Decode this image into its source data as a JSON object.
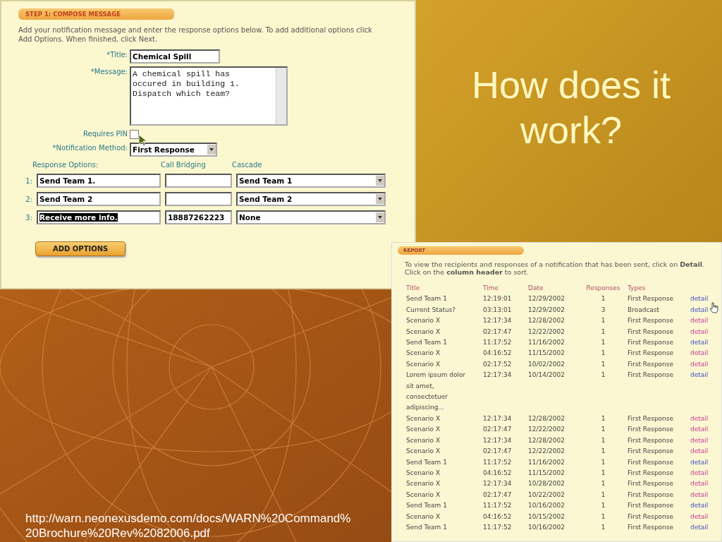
{
  "slide": {
    "title": "How does it work?",
    "source_url": "http://warn.neonexusdemo.com/docs/WARN%20Command%20Brochure%20Rev%2082006.pdf"
  },
  "compose": {
    "header": "STEP 1: COMPOSE MESSAGE",
    "instructions": "Add your notification message and enter the response options below. To add additional options click Add Options. When finished, click Next.",
    "title_label": "*Title:",
    "title_value": "Chemical Spill",
    "message_label": "*Message:",
    "message_value": "A chemical spill has occured in building 1. Dispatch which team?",
    "pin_label": "Requires PIN",
    "pin_checked": false,
    "method_label": "*Notification Method:",
    "method_value": "First Response",
    "columns": [
      "Response Options:",
      "Call Bridging",
      "Cascade"
    ],
    "options": [
      {
        "number": "1:",
        "response": "Send Team 1.",
        "cascade": "Send Team 1",
        "highlighted": false
      },
      {
        "number": "2:",
        "response": "Send Team 2",
        "cascade": "Send Team 2",
        "highlighted": false
      },
      {
        "number": "3:",
        "response": "Receive more info.",
        "bridging": "18887262223",
        "cascade": "None",
        "highlighted": true
      }
    ],
    "add_button": "ADD OPTIONS"
  },
  "report": {
    "header": "REPORT",
    "instructions": "To view the recipients and responses of a notification that has been sent, click on **Detail**. Click on the **column header** to sort.",
    "columns": [
      "Title",
      "Time",
      "Date",
      "Responses",
      "Types"
    ],
    "rows": [
      {
        "title": "Send Team 1",
        "time": "12:19:01",
        "date": "12/29/2002",
        "responses": "1",
        "type": "First Response",
        "link": "detail",
        "visited": false
      },
      {
        "title": "Current Status?",
        "time": "03:13:01",
        "date": "12/29/2002",
        "responses": "3",
        "type": "Broadcast",
        "link": "detail",
        "visited": false
      },
      {
        "title": "Scenario X",
        "time": "12:17:34",
        "date": "12/28/2002",
        "responses": "1",
        "type": "First Response",
        "link": "detail",
        "visited": true
      },
      {
        "title": "Scenario X",
        "time": "02:17:47",
        "date": "12/22/2002",
        "responses": "1",
        "type": "First Response",
        "link": "detail",
        "visited": true
      },
      {
        "title": "Send Team 1",
        "time": "11:17:52",
        "date": "11/16/2002",
        "responses": "1",
        "type": "First Response",
        "link": "detail",
        "visited": false
      },
      {
        "title": "Scenario X",
        "time": "04:16:52",
        "date": "11/15/2002",
        "responses": "1",
        "type": "First Response",
        "link": "detail",
        "visited": true
      },
      {
        "title": "Scenario X",
        "time": "02:17:52",
        "date": "10/02/2002",
        "responses": "1",
        "type": "First Response",
        "link": "detail",
        "visited": true
      },
      {
        "title": "Lorem ipsum dolor sit amet, consectetuer adipiscing...",
        "time": "12:17:34",
        "date": "10/14/2002",
        "responses": "1",
        "type": "First Response",
        "link": "detail",
        "visited": false
      },
      {
        "title": "Scenario X",
        "time": "12:17:34",
        "date": "12/28/2002",
        "responses": "1",
        "type": "First Response",
        "link": "detail",
        "visited": true
      },
      {
        "title": "Scenario X",
        "time": "02:17:47",
        "date": "12/22/2002",
        "responses": "1",
        "type": "First Response",
        "link": "detail",
        "visited": true
      },
      {
        "title": "Scenario X",
        "time": "12:17:34",
        "date": "12/28/2002",
        "responses": "1",
        "type": "First Response",
        "link": "detail",
        "visited": true
      },
      {
        "title": "Scenario X",
        "time": "02:17:47",
        "date": "12/22/2002",
        "responses": "1",
        "type": "First Response",
        "link": "detail",
        "visited": true
      },
      {
        "title": "Send Team 1",
        "time": "11:17:52",
        "date": "11/16/2002",
        "responses": "1",
        "type": "First Response",
        "link": "detail",
        "visited": false
      },
      {
        "title": "Scenario X",
        "time": "04:16:52",
        "date": "11/15/2002",
        "responses": "1",
        "type": "First Response",
        "link": "detail",
        "visited": true
      },
      {
        "title": "Scenario X",
        "time": "12:17:34",
        "date": "10/28/2002",
        "responses": "1",
        "type": "First Response",
        "link": "detail",
        "visited": true
      },
      {
        "title": "Scenario X",
        "time": "02:17:47",
        "date": "10/22/2002",
        "responses": "1",
        "type": "First Response",
        "link": "detail",
        "visited": true
      },
      {
        "title": "Send Team 1",
        "time": "11:17:52",
        "date": "10/16/2002",
        "responses": "1",
        "type": "First Response",
        "link": "detail",
        "visited": false
      },
      {
        "title": "Scenario X",
        "time": "04:16:52",
        "date": "10/15/2002",
        "responses": "1",
        "type": "First Response",
        "link": "detail",
        "visited": true
      },
      {
        "title": "Send Team 1",
        "time": "11:17:52",
        "date": "10/16/2002",
        "responses": "1",
        "type": "First Response",
        "link": "detail",
        "visited": false
      }
    ]
  }
}
